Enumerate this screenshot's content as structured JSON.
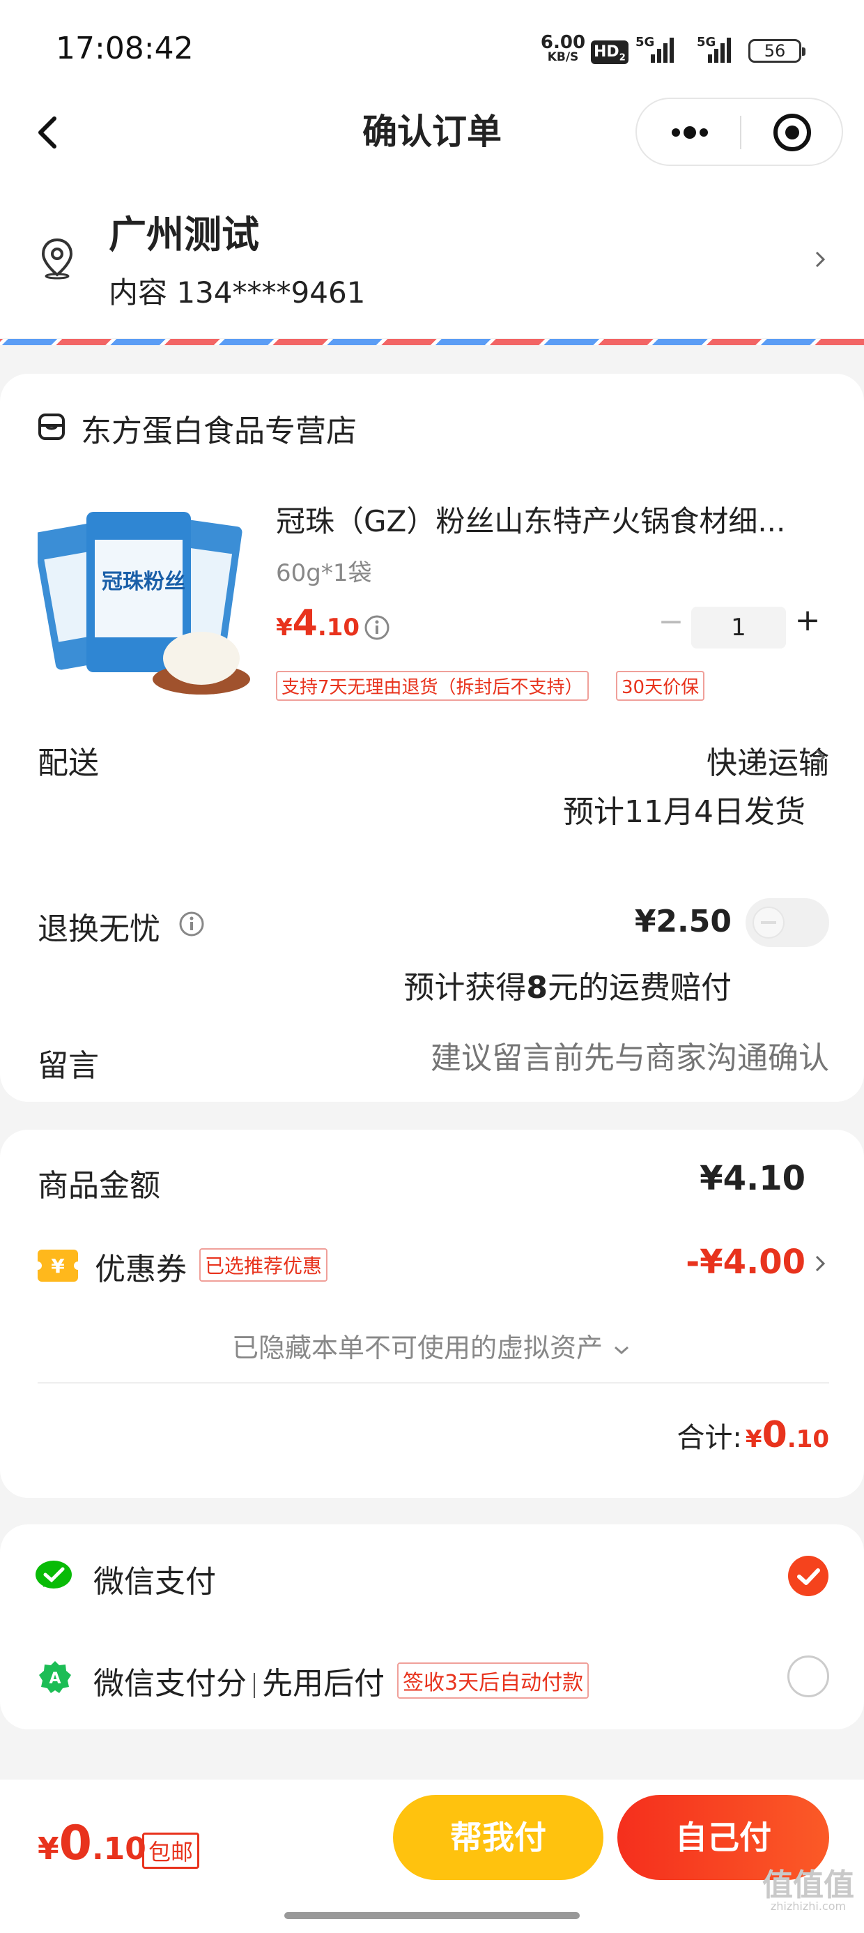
{
  "status_bar": {
    "time": "17:08:42",
    "net_speed_value": "6.00",
    "net_speed_unit": "KB/S",
    "hd_label": "HD",
    "hd_sub": "2",
    "signal1_label": "5G",
    "signal2_label": "5G",
    "battery": "56"
  },
  "nav": {
    "title": "确认订单",
    "more_icon": "more-icon",
    "target_icon": "target-icon"
  },
  "address": {
    "name": "广州测试",
    "detail": "内容 134****9461"
  },
  "store": {
    "name": "东方蛋白食品专营店",
    "product": {
      "title": "冠珠（GZ）粉丝山东特产火锅食材细...",
      "spec": "60g*1袋",
      "price_symbol": "¥",
      "price_int": "4",
      "price_dec": ".10",
      "quantity": "1",
      "minus": "−",
      "plus": "+",
      "tag1": "支持7天无理由退货（拆封后不支持）",
      "tag2": "30天价保"
    },
    "delivery": {
      "label": "配送",
      "method": "快递运输",
      "eta": "预计11月4日发货"
    },
    "return": {
      "label": "退换无忧",
      "price": "¥2.50",
      "note_prefix": "预计获得",
      "note_amount": "8",
      "note_suffix": "元的运费赔付"
    },
    "message": {
      "label": "留言",
      "placeholder": "建议留言前先与商家沟通确认"
    }
  },
  "summary": {
    "goods_label": "商品金额",
    "goods_value": "¥4.10",
    "coupon_label": "优惠券",
    "coupon_badge": "已选推荐优惠",
    "coupon_value": "-¥4.00",
    "hidden_assets": "已隐藏本单不可使用的虚拟资产",
    "total_label": "合计:",
    "total_symbol": "¥",
    "total_int": "0",
    "total_dec": ".10"
  },
  "payment": {
    "wechat_pay": "微信支付",
    "pay_later_a": "微信支付分",
    "pay_later_b": "先用后付",
    "pay_later_badge": "签收3天后自动付款"
  },
  "bottom_bar": {
    "symbol": "¥",
    "int": "0",
    "dec": ".10",
    "free_shipping": "包邮",
    "help_pay": "帮我付",
    "self_pay": "自己付"
  },
  "watermark": {
    "text": "值值值",
    "sub": "zhizhizhi.com"
  },
  "colors": {
    "accent_red": "#e8331d",
    "yellow_btn": "#ffc20e",
    "red_btn": "#f5431d",
    "wechat_green": "#09bb07"
  }
}
